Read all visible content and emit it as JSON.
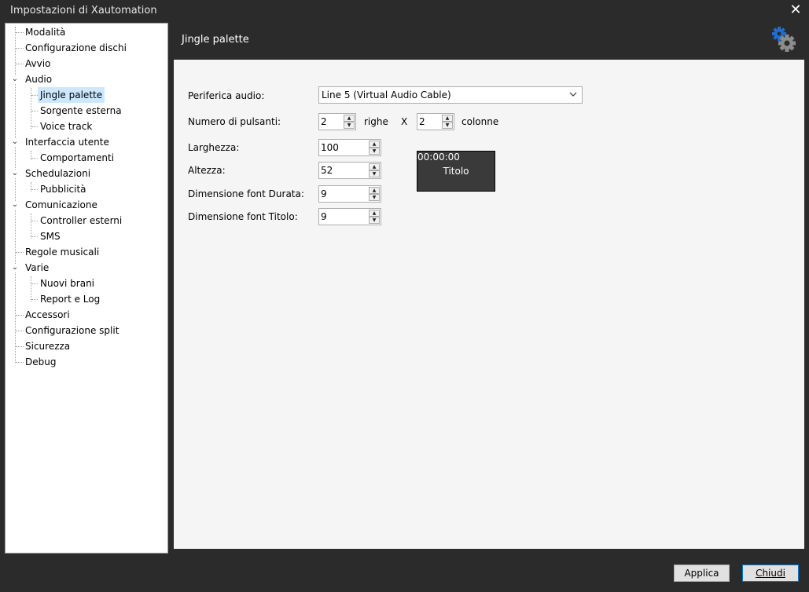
{
  "window": {
    "title": "Impostazioni di Xautomation",
    "close_glyph": "✕"
  },
  "sidebar": {
    "items": [
      {
        "label": "Modalità"
      },
      {
        "label": "Configurazione dischi"
      },
      {
        "label": "Avvio"
      },
      {
        "label": "Audio",
        "expanded": true
      },
      {
        "label": "Jingle palette",
        "selected": true
      },
      {
        "label": "Sorgente esterna"
      },
      {
        "label": "Voice track"
      },
      {
        "label": "Interfaccia utente",
        "expanded": true
      },
      {
        "label": "Comportamenti"
      },
      {
        "label": "Schedulazioni",
        "expanded": true
      },
      {
        "label": "Pubblicità"
      },
      {
        "label": "Comunicazione",
        "expanded": true
      },
      {
        "label": "Controller esterni"
      },
      {
        "label": "SMS"
      },
      {
        "label": "Regole musicali"
      },
      {
        "label": "Varie",
        "expanded": true
      },
      {
        "label": "Nuovi brani"
      },
      {
        "label": "Report e Log"
      },
      {
        "label": "Accessori"
      },
      {
        "label": "Configurazione split"
      },
      {
        "label": "Sicurezza"
      },
      {
        "label": "Debug"
      }
    ]
  },
  "header": {
    "title": "Jingle palette",
    "icon": "gears-icon"
  },
  "form": {
    "audio_device_label": "Periferica audio:",
    "audio_device_value": "Line 5 (Virtual Audio Cable)",
    "buttons_label": "Numero di pulsanti:",
    "rows_value": "2",
    "rows_label": "righe",
    "times": "X",
    "cols_value": "2",
    "cols_label": "colonne",
    "width_label": "Larghezza:",
    "width_value": "100",
    "height_label": "Altezza:",
    "height_value": "52",
    "font_duration_label": "Dimensione font Durata:",
    "font_duration_value": "9",
    "font_title_label": "Dimensione font Titolo:",
    "font_title_value": "9"
  },
  "preview": {
    "duration": "00:00:00",
    "title": "Titolo"
  },
  "footer": {
    "apply_label": "Applica",
    "close_label": "Chiudi"
  },
  "colors": {
    "dark_bg": "#2b2b2b",
    "panel_bg": "#f5f5f5",
    "selection": "#cce8ff",
    "gear_blue": "#1f6fd1"
  }
}
